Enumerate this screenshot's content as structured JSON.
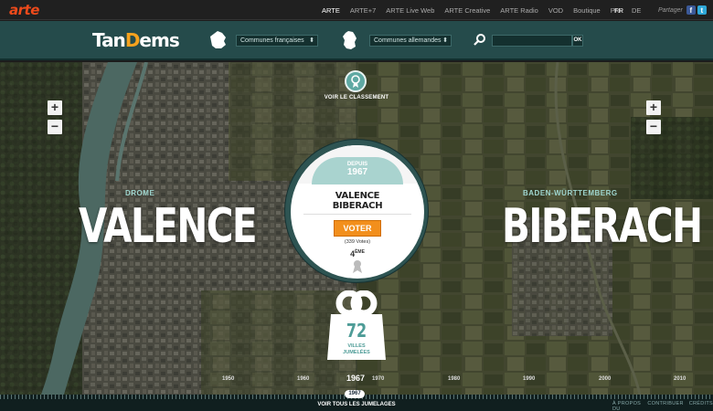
{
  "arte": {
    "logo": "arte",
    "nav": [
      "ARTE",
      "ARTE+7",
      "ARTE Live Web",
      "ARTE Creative",
      "ARTE Radio",
      "VOD",
      "Boutique",
      "Pro"
    ],
    "languages": [
      "FR",
      "DE"
    ],
    "share_label": "Partager",
    "share_icons": [
      "facebook-icon",
      "twitter-icon"
    ]
  },
  "header": {
    "brand_before": "Tan",
    "brand_o": "D",
    "brand_after": "ems",
    "select_fr": "Communes françaises",
    "select_de": "Communes allemandes",
    "ok_label": "OK",
    "icons": [
      "france-flag-icon",
      "germany-flag-icon",
      "search-icon"
    ]
  },
  "map": {
    "rank_label": "VOIR LE CLASSEMENT",
    "zoom_in": "+",
    "zoom_out": "−",
    "left_region": "DROME",
    "left_city": "VALENCE",
    "right_region": "BADEN-WÜRTTEMBERG",
    "right_city": "BIBERACH"
  },
  "card": {
    "since_label": "DEPUIS",
    "since_year": "1967",
    "city_a": "VALENCE",
    "city_b": "BIBERACH",
    "vote_label": "VOTER",
    "votes_text": "(339 Votes)",
    "rank_num": "4",
    "rank_suffix": "ÈME"
  },
  "counter": {
    "count": "72",
    "line1": "VILLES",
    "line2": "JUMELÉES"
  },
  "timeline": {
    "years": [
      "1950",
      "1960",
      "1970",
      "1980",
      "1990",
      "2000",
      "2010"
    ],
    "current_year": "1967",
    "pill_year": "1967",
    "see_all": "VOIR TOUS LES JUMELAGES"
  },
  "footer": {
    "links": [
      "À PROPOS DU PROJET",
      "CONTRIBUER",
      "CRÉDITS"
    ]
  },
  "colors": {
    "header_bg": "#254b4b",
    "accent_orange": "#f28f1c",
    "teal": "#4e9c97",
    "arte_red": "#ee4a1b"
  }
}
